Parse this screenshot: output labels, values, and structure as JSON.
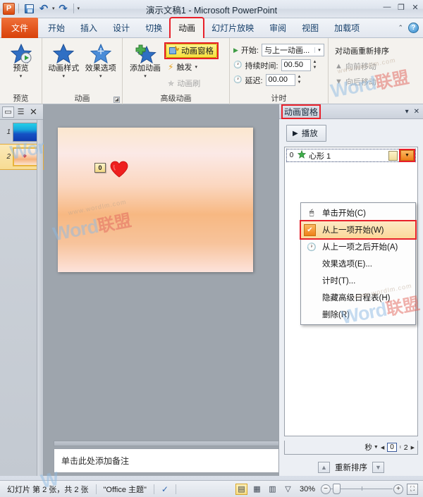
{
  "titlebar": {
    "document_title": "演示文稿1  -  Microsoft PowerPoint",
    "qat": {
      "logo": "P",
      "save_icon": "save-icon",
      "undo_icon": "undo-icon",
      "redo_icon": "redo-icon",
      "customize_icon": "customize-qat-icon"
    },
    "window_controls": {
      "minimize": "—",
      "restore": "❐",
      "close": "✕"
    }
  },
  "tabs": [
    {
      "label": "文件",
      "type": "file"
    },
    {
      "label": "开始",
      "type": "normal"
    },
    {
      "label": "插入",
      "type": "normal"
    },
    {
      "label": "设计",
      "type": "normal"
    },
    {
      "label": "切换",
      "type": "normal"
    },
    {
      "label": "动画",
      "type": "active",
      "highlighted": true
    },
    {
      "label": "幻灯片放映",
      "type": "normal"
    },
    {
      "label": "审阅",
      "type": "normal"
    },
    {
      "label": "视图",
      "type": "normal"
    },
    {
      "label": "加载项",
      "type": "normal"
    }
  ],
  "tab_right": {
    "collapse_ribbon": "⌃",
    "help": "?"
  },
  "ribbon": {
    "groups": [
      {
        "label": "预览",
        "buttons": [
          {
            "label": "预览",
            "caret": "▾"
          }
        ]
      },
      {
        "label": "动画",
        "buttons": [
          {
            "label": "动画样式",
            "caret": "▾"
          },
          {
            "label": "效果选项",
            "caret": "▾"
          }
        ],
        "dialog_launcher": "◪"
      },
      {
        "label": "高级动画",
        "buttons": [
          {
            "label": "添加动画",
            "caret": "▾"
          }
        ],
        "items": [
          {
            "label": "动画窗格",
            "state": "toggled-on",
            "highlighted": true
          },
          {
            "label": "触发",
            "caret": "▾",
            "state": "enabled"
          },
          {
            "label": "动画刷",
            "state": "disabled"
          }
        ]
      },
      {
        "label": "计时",
        "fields": [
          {
            "label": "开始:",
            "value": "与上一动画...",
            "type": "combo"
          },
          {
            "label": "持续时间:",
            "value": "00.50",
            "type": "spinner"
          },
          {
            "label": "延迟:",
            "value": "00.00",
            "type": "spinner"
          }
        ]
      },
      {
        "label": "",
        "reorder_title": "对动画重新排序",
        "items": [
          {
            "label": "向前移动",
            "state": "disabled"
          },
          {
            "label": "向后移动",
            "state": "disabled"
          }
        ]
      }
    ]
  },
  "slides_panel": {
    "header_buttons": [
      "minimize-panel-icon",
      "outline-view-icon",
      "close-panel-icon"
    ],
    "thumbnails": [
      {
        "number": "1",
        "selected": false
      },
      {
        "number": "2",
        "selected": true
      }
    ]
  },
  "slide_canvas": {
    "shape_name": "heart-shape",
    "animation_tag": "0"
  },
  "notes": {
    "placeholder": "单击此处添加备注"
  },
  "animation_pane": {
    "title": "动画窗格",
    "header_buttons": {
      "options": "▾",
      "close": "✕"
    },
    "play_button": "播放",
    "items": [
      {
        "number": "0",
        "icon": "entrance-effect-icon",
        "name": "心形 1",
        "timeline_bar": true,
        "dropdown_highlighted": true
      }
    ],
    "context_menu": [
      {
        "label": "单击开始(C)",
        "icon": "mouse-click-icon",
        "checked": false
      },
      {
        "label": "从上一项开始(W)",
        "icon": "check-icon",
        "checked": true,
        "highlighted": true
      },
      {
        "label": "从上一项之后开始(A)",
        "icon": "clock-icon",
        "checked": false
      },
      {
        "label": "效果选项(E)...",
        "icon": "",
        "checked": false
      },
      {
        "label": "计时(T)...",
        "icon": "",
        "checked": false
      },
      {
        "label": "隐藏高级日程表(H)",
        "icon": "",
        "checked": false
      },
      {
        "label": "删除(R)",
        "icon": "",
        "checked": false
      }
    ],
    "timeline": {
      "unit_label": "秒",
      "start": "0",
      "end": "2"
    },
    "reorder": {
      "label": "重新排序",
      "up": "▲",
      "down": "▼"
    }
  },
  "status_bar": {
    "slide_info": "幻灯片 第 2 张，共 2 张",
    "theme": "\"Office 主题\"",
    "spellcheck_icon": "spellcheck-icon",
    "views": [
      {
        "name": "normal-view",
        "glyph": "▤",
        "selected": true
      },
      {
        "name": "slide-sorter-view",
        "glyph": "▦",
        "selected": false
      },
      {
        "name": "reading-view",
        "glyph": "▥",
        "selected": false
      },
      {
        "name": "slideshow-view",
        "glyph": "▽",
        "selected": false
      }
    ],
    "zoom_level": "30%",
    "zoom_out": "−",
    "zoom_in": "+",
    "fit_window": "⛶"
  },
  "watermarks": [
    {
      "text": "Word联盟",
      "sub": "www.wordlm.com"
    }
  ],
  "colors": {
    "accent_orange": "#ef7f18",
    "annotation_red": "#e8202a",
    "highlight_yellow": "#f7e040",
    "file_tab": "#d8410a"
  }
}
